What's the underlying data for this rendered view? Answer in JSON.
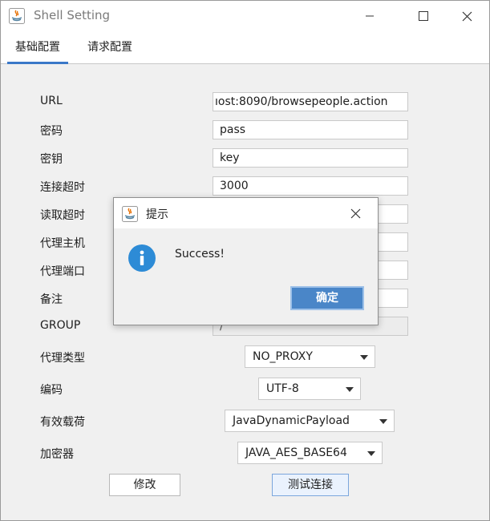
{
  "window": {
    "title": "Shell Setting"
  },
  "tabs": [
    {
      "label": "基础配置",
      "active": true
    },
    {
      "label": "请求配置",
      "active": false
    }
  ],
  "form": {
    "url": {
      "label": "URL",
      "value": "ıost:8090/browsepeople.action"
    },
    "password": {
      "label": "密码",
      "value": "pass"
    },
    "secret_key": {
      "label": "密钥",
      "value": "key"
    },
    "connect_timeout": {
      "label": "连接超时",
      "value": "3000"
    },
    "read_timeout": {
      "label": "读取超时",
      "value": ""
    },
    "proxy_host": {
      "label": "代理主机",
      "value": ""
    },
    "proxy_port": {
      "label": "代理端口",
      "value": ""
    },
    "remark": {
      "label": "备注",
      "value": ""
    },
    "group": {
      "label": "GROUP",
      "value": "/"
    },
    "proxy_type": {
      "label": "代理类型",
      "value": "NO_PROXY"
    },
    "encoding": {
      "label": "编码",
      "value": "UTF-8"
    },
    "payload": {
      "label": "有效载荷",
      "value": "JavaDynamicPayload"
    },
    "cryption": {
      "label": "加密器",
      "value": "JAVA_AES_BASE64"
    }
  },
  "buttons": {
    "modify": "修改",
    "test_connection": "测试连接"
  },
  "dialog": {
    "title": "提示",
    "message": "Success!",
    "ok": "确定",
    "icon": "info-icon"
  },
  "colors": {
    "accent": "#3a78c8",
    "ok_button": "#4a86c8",
    "info_icon": "#2d8bd6"
  }
}
